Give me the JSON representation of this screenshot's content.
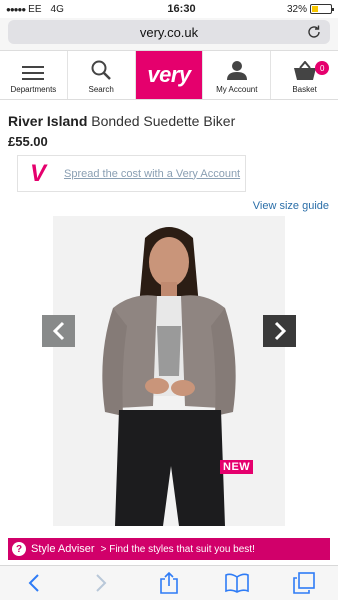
{
  "status": {
    "carrier": "EE",
    "network": "4G",
    "time": "16:30",
    "battery_text": "32%",
    "battery_level": 0.32
  },
  "browser": {
    "url": "very.co.uk"
  },
  "nav": {
    "departments": "Departments",
    "search": "Search",
    "logo": "very",
    "account": "My Account",
    "basket": "Basket",
    "basket_count": "0"
  },
  "product": {
    "brand": "River Island",
    "name": "Bonded Suedette Biker",
    "price": "£55.00"
  },
  "finance": {
    "logo": "V",
    "link": "Spread the cost with a Very Account"
  },
  "size_guide": "View size guide",
  "image_badge": "NEW",
  "style_adviser": {
    "icon": "?",
    "label": "Style Adviser",
    "text": "> Find the styles that suit you best!"
  },
  "colors": {
    "brand_pink": "#e5006d",
    "link_blue": "#2a6ea8"
  }
}
